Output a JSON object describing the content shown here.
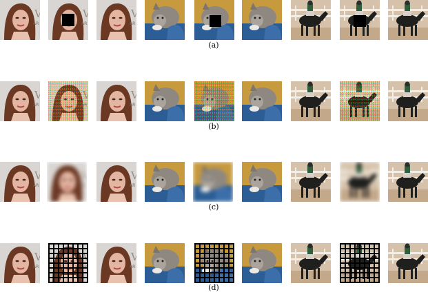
{
  "captions": {
    "a": "(a)",
    "b": "(b)",
    "c": "(c)",
    "d": "(d)"
  }
}
